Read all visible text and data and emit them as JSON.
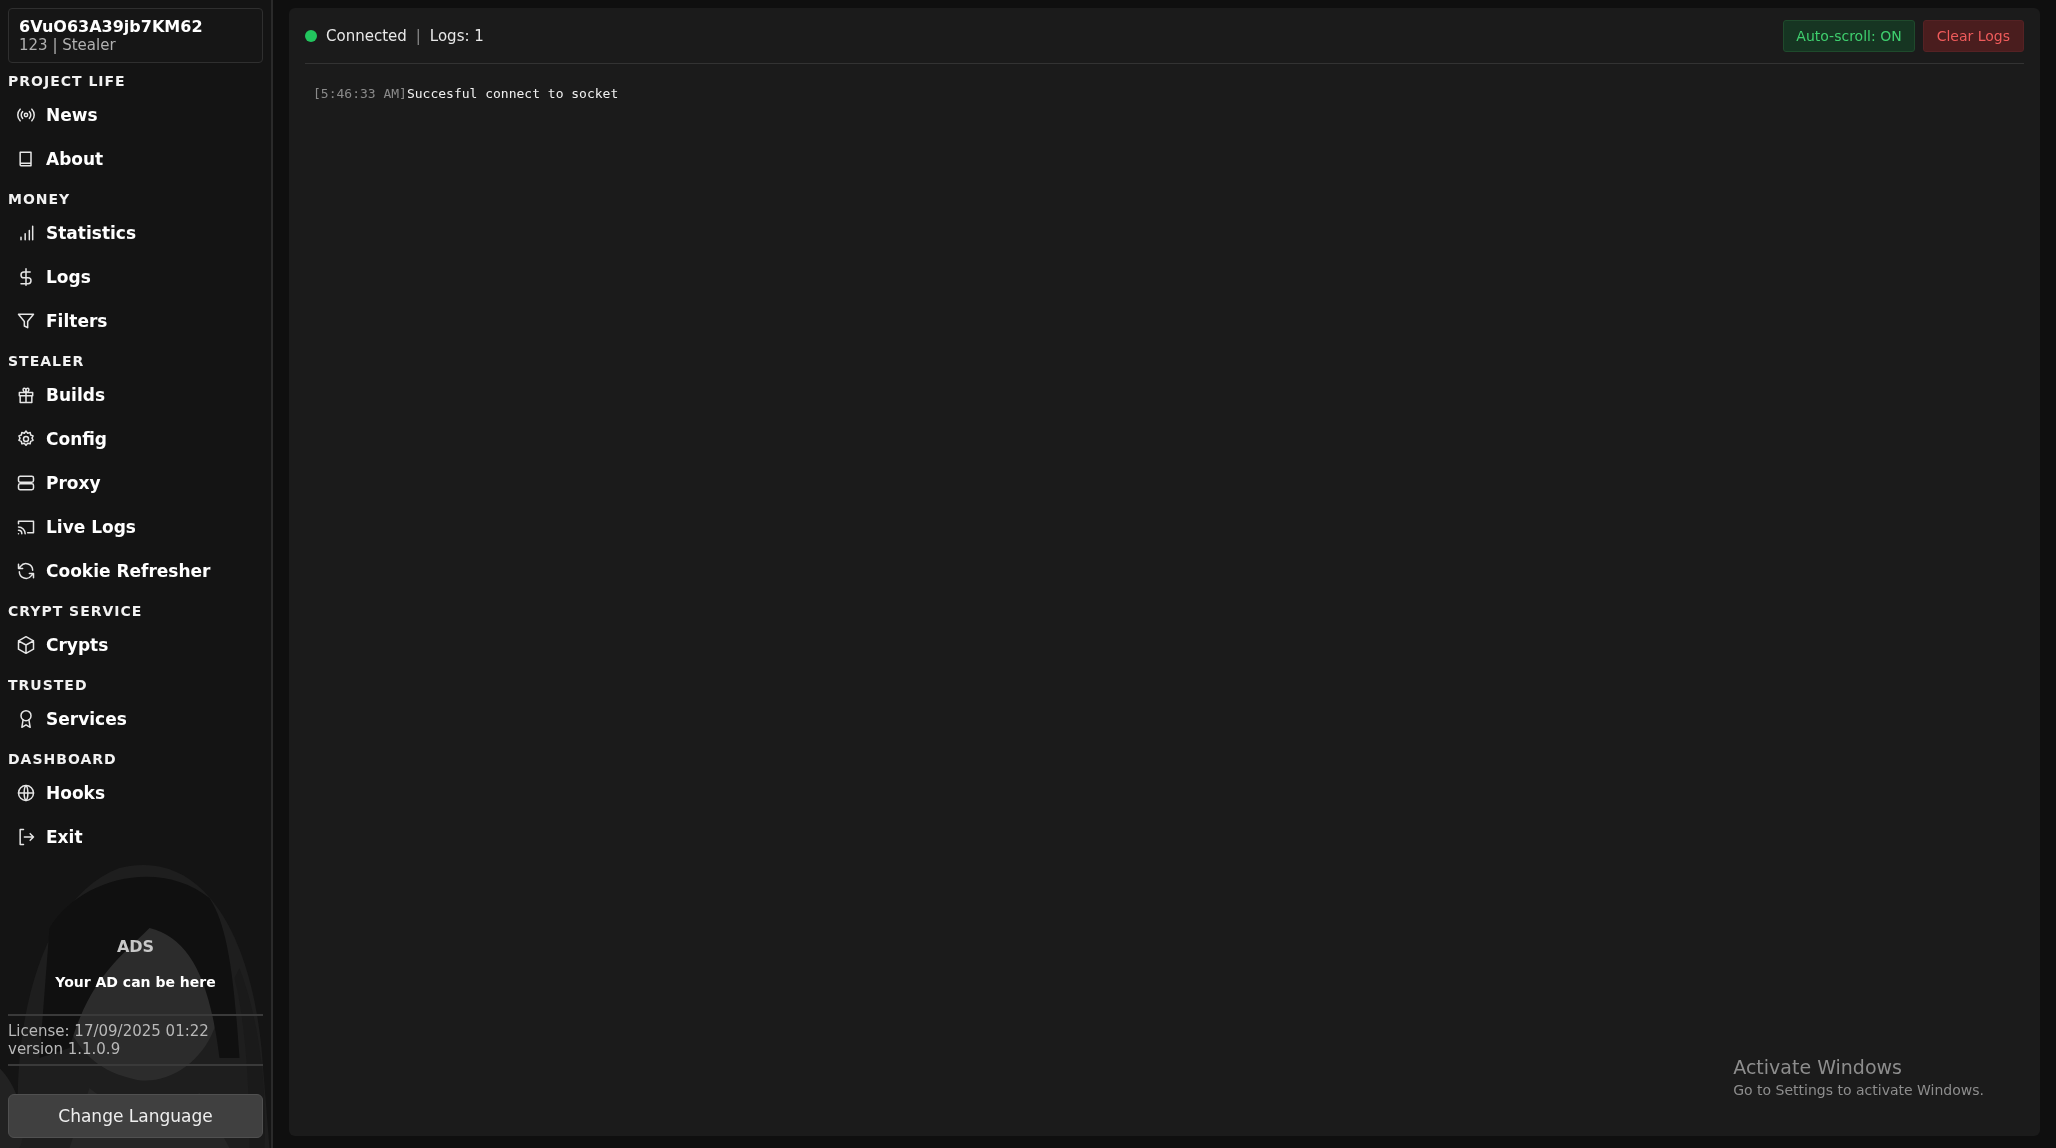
{
  "account": {
    "id": "6VuO63A39jb7KM62",
    "subtitle": "123 | Stealer"
  },
  "sidebar": {
    "sections": [
      {
        "heading": "PROJECT LIFE",
        "items": [
          "News",
          "About"
        ]
      },
      {
        "heading": "MONEY",
        "items": [
          "Statistics",
          "Logs",
          "Filters"
        ]
      },
      {
        "heading": "STEALER",
        "items": [
          "Builds",
          "Config",
          "Proxy",
          "Live Logs",
          "Cookie Refresher"
        ]
      },
      {
        "heading": "CRYPT SERVICE",
        "items": [
          "Crypts"
        ]
      },
      {
        "heading": "TRUSTED",
        "items": [
          "Services"
        ]
      },
      {
        "heading": "DASHBOARD",
        "items": [
          "Hooks",
          "Exit"
        ]
      }
    ],
    "ads": {
      "title": "ADS",
      "text": "Your AD can be here"
    },
    "license": "License: 17/09/2025 01:22",
    "version": "version 1.1.0.9",
    "language_button": "Change Language"
  },
  "status": {
    "connected": true,
    "label": "Connected",
    "separator": "|",
    "count": "Logs: 1"
  },
  "autoscroll": {
    "label": "Auto-scroll: ON",
    "on": true
  },
  "clear_button": "Clear Logs",
  "log_lines": [
    {
      "time": "[5:46:33 AM]",
      "message": "Succesful connect to socket"
    }
  ],
  "os_notice": {
    "title": "Activate Windows",
    "text": "Go to Settings to activate Windows."
  }
}
